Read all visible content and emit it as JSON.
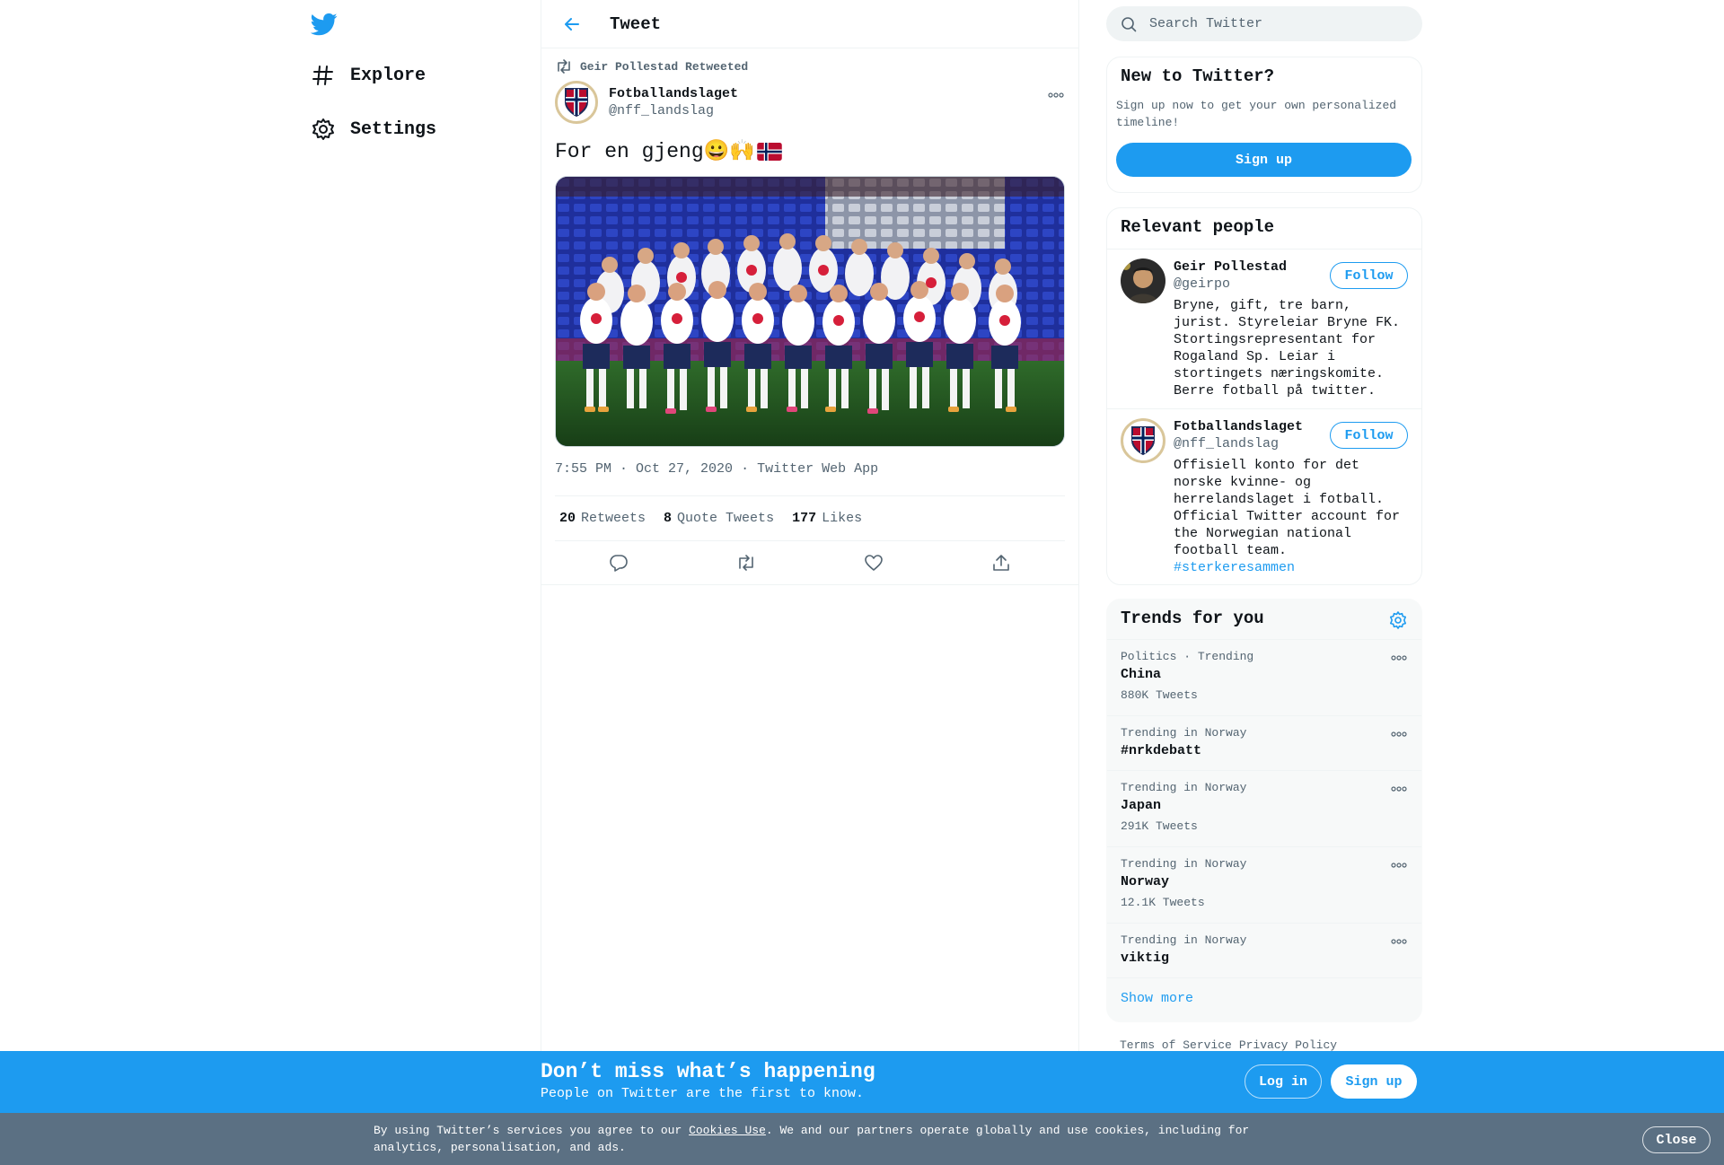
{
  "nav": {
    "logo_icon": "twitter-bird-icon",
    "items": [
      {
        "label": "Explore",
        "icon": "hashtag-icon"
      },
      {
        "label": "Settings",
        "icon": "gear-icon"
      }
    ]
  },
  "header": {
    "title": "Tweet",
    "back_icon": "back-arrow-icon"
  },
  "tweet": {
    "retweeted_by": "Geir Pollestad Retweeted",
    "author_name": "Fotballandslaget",
    "author_handle": "@nff_landslag",
    "text": "For en gjeng😀🙌",
    "flag_emoji": "norway-flag",
    "photo_description": "team-photo",
    "timestamp": "7:55 PM · Oct 27, 2020",
    "separator": "·",
    "client": "Twitter Web App",
    "stats": {
      "retweets_count": "20",
      "retweets_label": "Retweets",
      "quotes_count": "8",
      "quotes_label": "Quote Tweets",
      "likes_count": "177",
      "likes_label": "Likes"
    }
  },
  "search": {
    "placeholder": "Search Twitter"
  },
  "new_to_twitter": {
    "title": "New to Twitter?",
    "subtitle": "Sign up now to get your own personalized timeline!",
    "button": "Sign up"
  },
  "relevant_people": {
    "title": "Relevant people",
    "people": [
      {
        "name": "Geir Pollestad",
        "handle": "@geirpo",
        "bio": "Bryne, gift, tre barn, jurist. Styreleiar Bryne FK. Stortingsrepresentant for Rogaland Sp. Leiar i stortingets næringskomite. Berre fotball på twitter.",
        "button": "Follow"
      },
      {
        "name": "Fotballandslaget",
        "handle": "@nff_landslag",
        "bio": "Offisiell konto for det norske kvinne- og herrelandslaget i fotball. Official Twitter account for the Norwegian national football team.",
        "bio_tag": "#sterkeresammen",
        "button": "Follow"
      }
    ]
  },
  "trends": {
    "title": "Trends for you",
    "items": [
      {
        "context": "Politics · Trending",
        "name": "China",
        "count": "880K Tweets"
      },
      {
        "context": "Trending in Norway",
        "name": "#nrkdebatt",
        "count": ""
      },
      {
        "context": "Trending in Norway",
        "name": "Japan",
        "count": "291K Tweets"
      },
      {
        "context": "Trending in Norway",
        "name": "Norway",
        "count": "12.1K Tweets"
      },
      {
        "context": "Trending in Norway",
        "name": "viktig",
        "count": ""
      }
    ],
    "show_more": "Show more"
  },
  "footer": {
    "terms": "Terms of Service",
    "privacy": "Privacy Policy"
  },
  "banner": {
    "title": "Don’t miss what’s happening",
    "subtitle": "People on Twitter are the first to know.",
    "login": "Log in",
    "signup": "Sign up"
  },
  "cookie": {
    "prefix": "By using Twitter’s services you agree to our ",
    "link": "Cookies Use",
    "suffix": ". We and our partners operate globally and use cookies, including for analytics, personalisation, and ads.",
    "close": "Close"
  },
  "colors": {
    "accent": "#1d9bf0",
    "text_secondary": "#536471",
    "cookie_bar": "#5b7083"
  }
}
